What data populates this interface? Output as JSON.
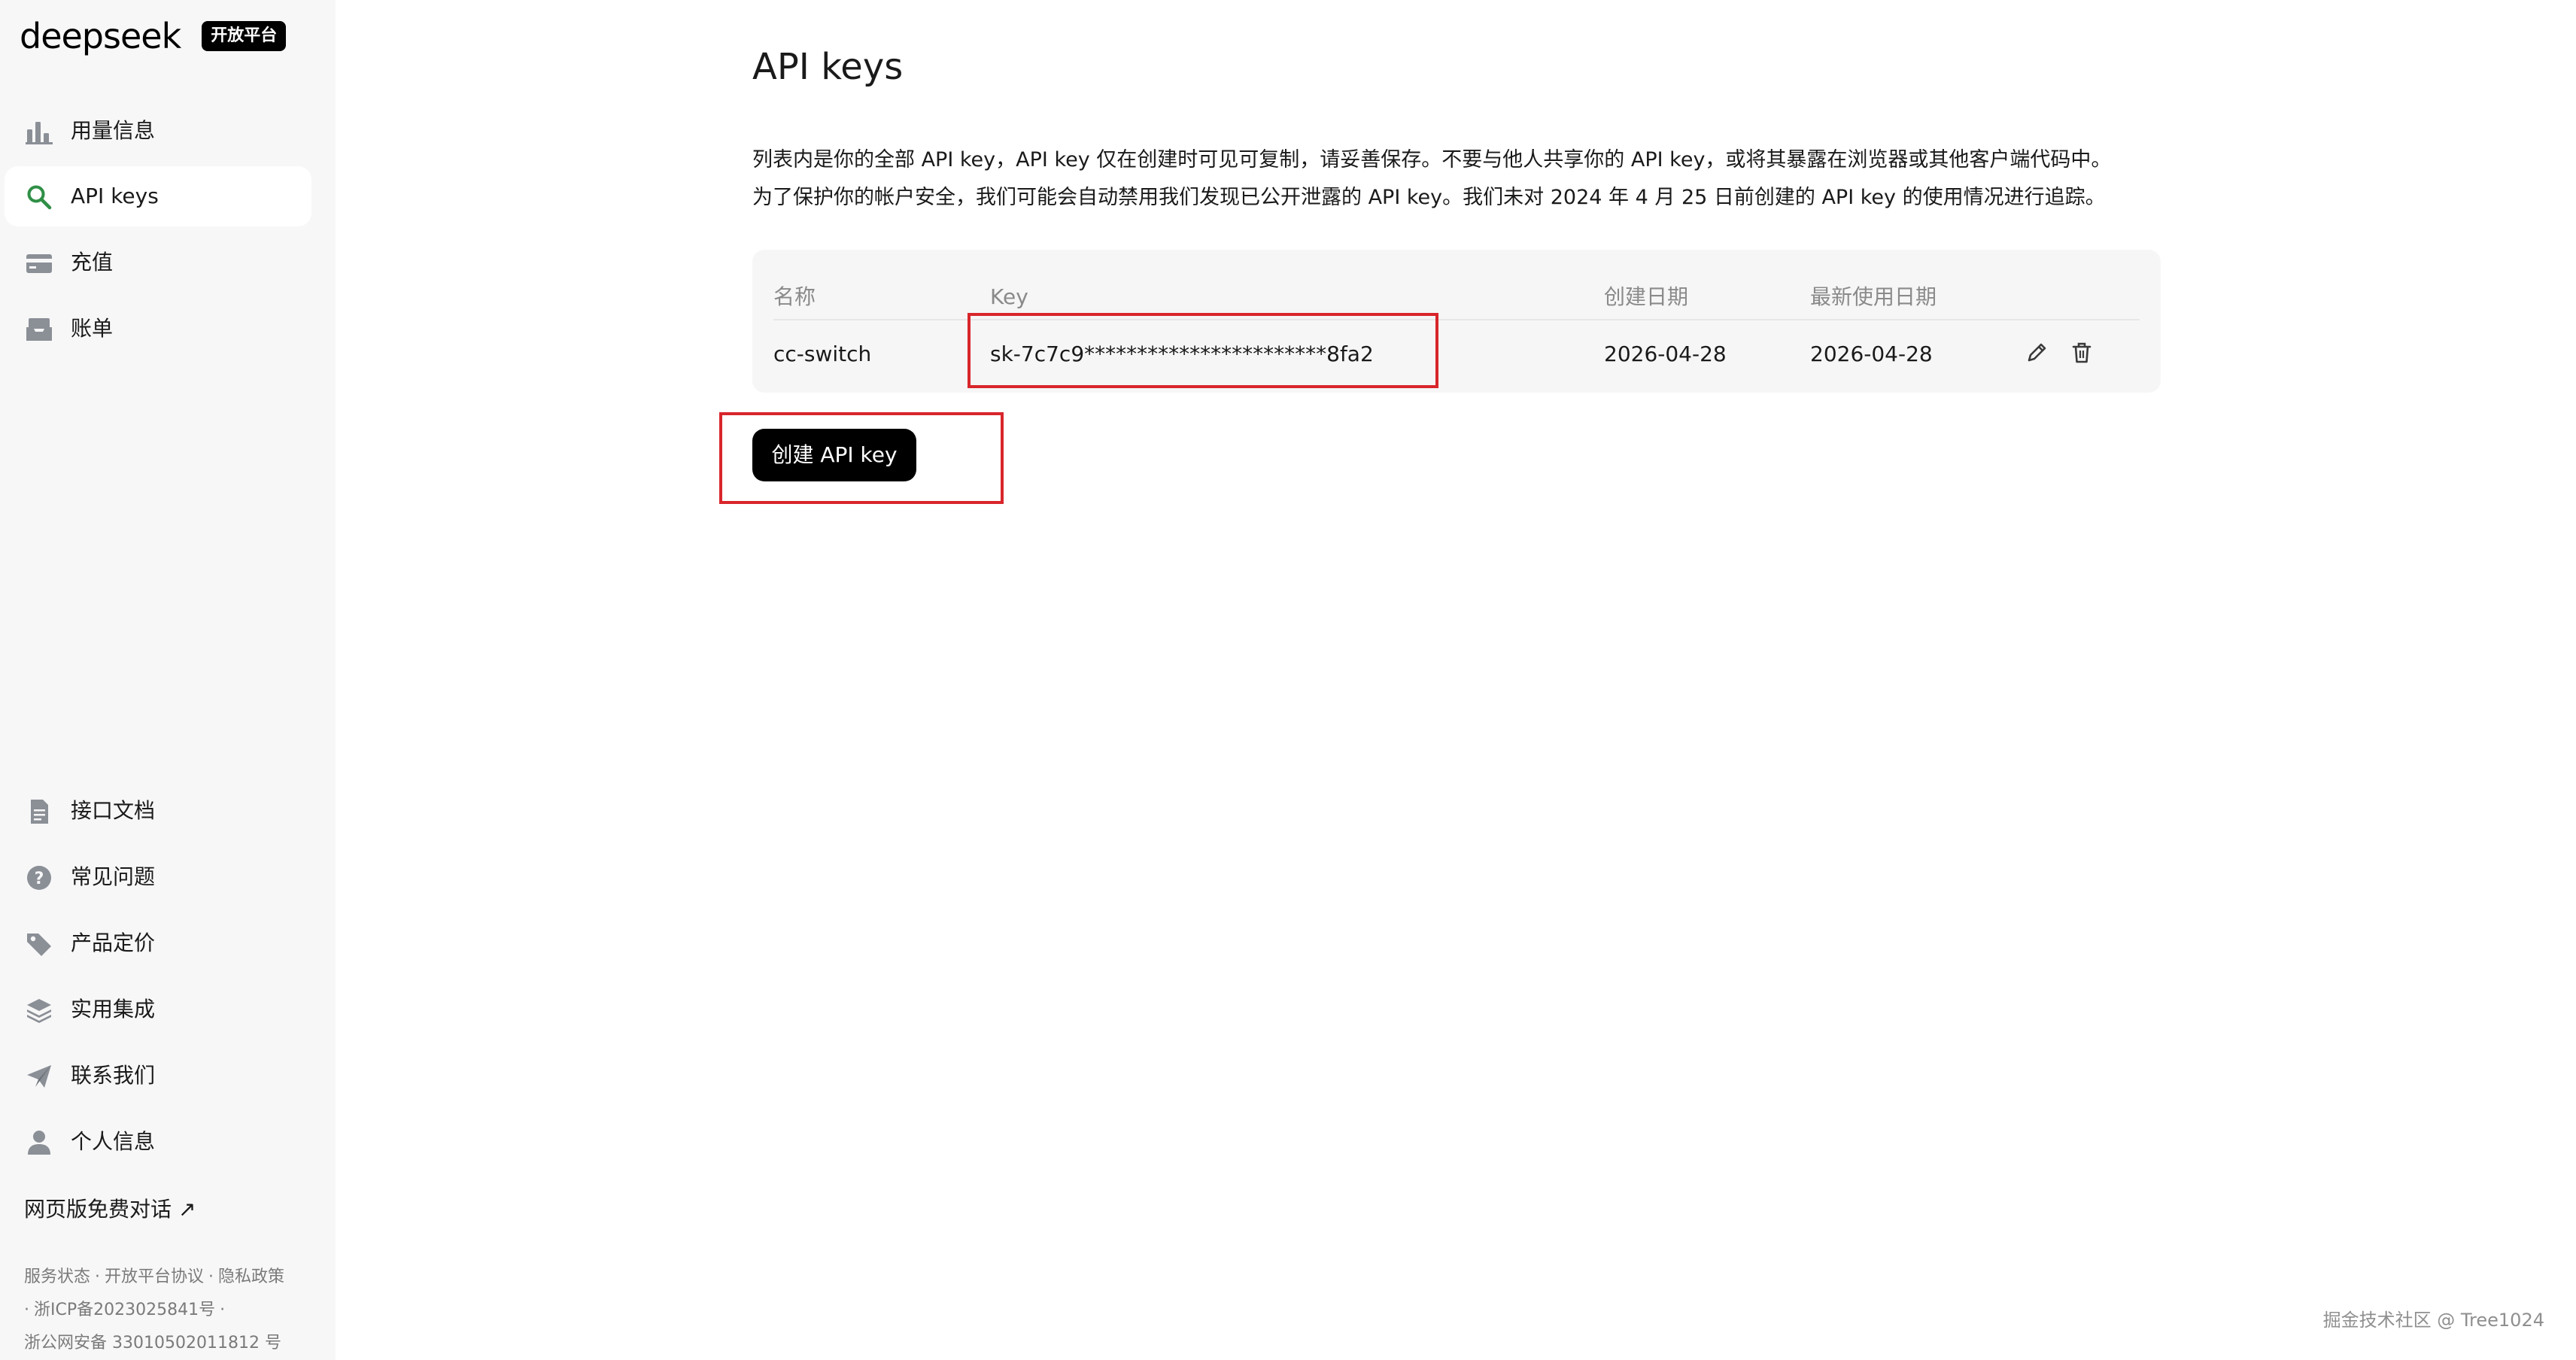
{
  "brand": {
    "logo": "deepseek",
    "badge": "开放平台"
  },
  "sidebar": {
    "items": [
      {
        "label": "用量信息",
        "icon": "bar-chart-icon"
      },
      {
        "label": "API keys",
        "icon": "search-key-icon",
        "active": true
      },
      {
        "label": "充值",
        "icon": "card-icon"
      },
      {
        "label": "账单",
        "icon": "inbox-icon"
      }
    ],
    "bottom_items": [
      {
        "label": "接口文档",
        "icon": "document-icon"
      },
      {
        "label": "常见问题",
        "icon": "question-icon"
      },
      {
        "label": "产品定价",
        "icon": "tag-icon"
      },
      {
        "label": "实用集成",
        "icon": "layers-icon"
      },
      {
        "label": "联系我们",
        "icon": "send-icon"
      },
      {
        "label": "个人信息",
        "icon": "user-icon"
      }
    ],
    "web_chat": "网页版免费对话 ↗",
    "footer": {
      "service_status": "服务状态",
      "open_platform_agreement": "开放平台协议",
      "privacy_policy": "隐私政策",
      "icp": "浙ICP备2023025841号",
      "police_record": "浙公网安备 33010502011812 号",
      "separator": "·"
    }
  },
  "main": {
    "title": "API keys",
    "description_line1": "列表内是你的全部 API key，API key 仅在创建时可见可复制，请妥善保存。不要与他人共享你的 API key，或将其暴露在浏览器或其他客户端代码中。",
    "description_line2": "为了保护你的帐户安全，我们可能会自动禁用我们发现已公开泄露的 API key。我们未对 2024 年 4 月 25 日前创建的 API key 的使用情况进行追踪。",
    "table": {
      "headers": {
        "name": "名称",
        "key": "Key",
        "created": "创建日期",
        "last_used": "最新使用日期"
      },
      "rows": [
        {
          "name": "cc-switch",
          "key": "sk-7c7c9***********************8fa2",
          "created": "2026-04-28",
          "last_used": "2026-04-28"
        }
      ]
    },
    "create_button": "创建 API key"
  },
  "colors": {
    "accent_green": "#2f8f46",
    "highlight_red": "#d8262b",
    "sidebar_bg": "#f7f7f8",
    "button_bg": "#000000"
  },
  "watermark": "掘金技术社区 @ Tree1024"
}
